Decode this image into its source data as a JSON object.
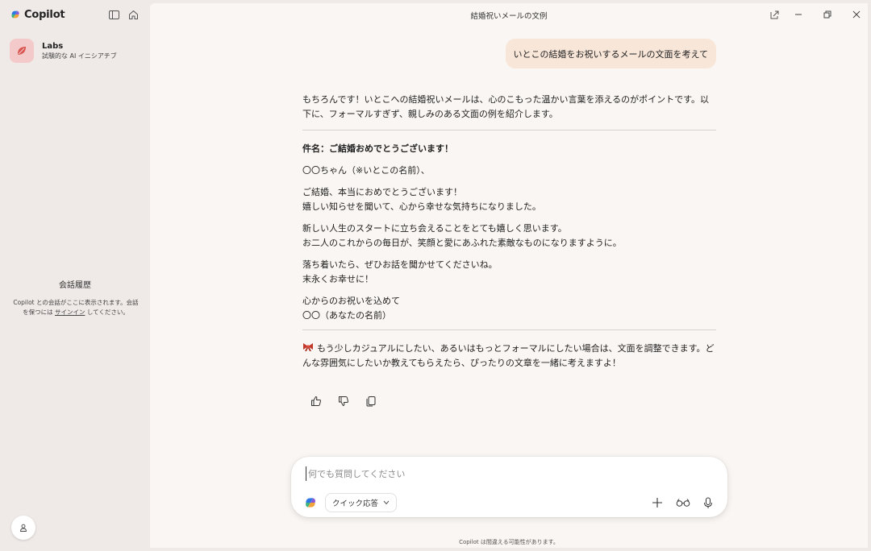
{
  "app": {
    "name": "Copilot"
  },
  "window": {
    "title": "結婚祝いメールの文例"
  },
  "sidebar": {
    "labs": {
      "title": "Labs",
      "subtitle": "試験的な AI イニシアチブ"
    },
    "history": {
      "title": "会話履歴",
      "desc_before": "Copilot との会話がここに表示されます。会話を保つには ",
      "signin_link": "サインイン",
      "desc_after": " してください。"
    }
  },
  "conversation": {
    "user_message": "いとこの結婚をお祝いするメールの文面を考えて",
    "answer": {
      "intro": "もちろんです！いとこへの結婚祝いメールは、心のこもった温かい言葉を添えるのがポイントです。以下に、フォーマルすぎず、親しみのある文面の例を紹介します。",
      "subject": "件名：ご結婚おめでとうございます！",
      "greeting": "〇〇ちゃん（※いとこの名前）、",
      "para1_line1": "ご結婚、本当におめでとうございます！",
      "para1_line2": "嬉しい知らせを聞いて、心から幸せな気持ちになりました。",
      "para2_line1": "新しい人生のスタートに立ち会えることをとても嬉しく思います。",
      "para2_line2": "お二人のこれからの毎日が、笑顔と愛にあふれた素敵なものになりますように。",
      "para3_line1": "落ち着いたら、ぜひお話を聞かせてくださいね。",
      "para3_line2": "末永くお幸せに！",
      "signoff_line1": "心からのお祝いを込めて",
      "signoff_line2": "〇〇（あなたの名前）",
      "closing": "もう少しカジュアルにしたい、あるいはもっとフォーマルにしたい場合は、文面を調整できます。どんな雰囲気にしたいか教えてもらえたら、ぴったりの文章を一緒に考えますよ！"
    }
  },
  "composer": {
    "placeholder": "何でも質問してください",
    "mode_label": "クイック応答"
  },
  "footer": {
    "disclaimer": "Copilot は間違える可能性があります。"
  },
  "icons": {
    "sidebar_toggle": "sidebar-toggle-icon",
    "home": "home-icon",
    "labs": "labs-leaf-icon",
    "profile": "person-icon",
    "new_window": "pop-out-icon",
    "minimize": "minimize-icon",
    "restore": "restore-icon",
    "close": "close-icon",
    "ribbon": "ribbon-icon",
    "thumbs_up": "thumbs-up-icon",
    "thumbs_down": "thumbs-down-icon",
    "copy": "copy-icon",
    "add": "plus-icon",
    "glasses": "glasses-icon",
    "microphone": "microphone-icon"
  },
  "colors": {
    "user_bubble": "#f8e6d8",
    "main_bg": "#faf6f3",
    "sidebar_bg": "#efeae8",
    "labs_icon_bg": "#f4c9c9",
    "ribbon": "#c0392b"
  }
}
